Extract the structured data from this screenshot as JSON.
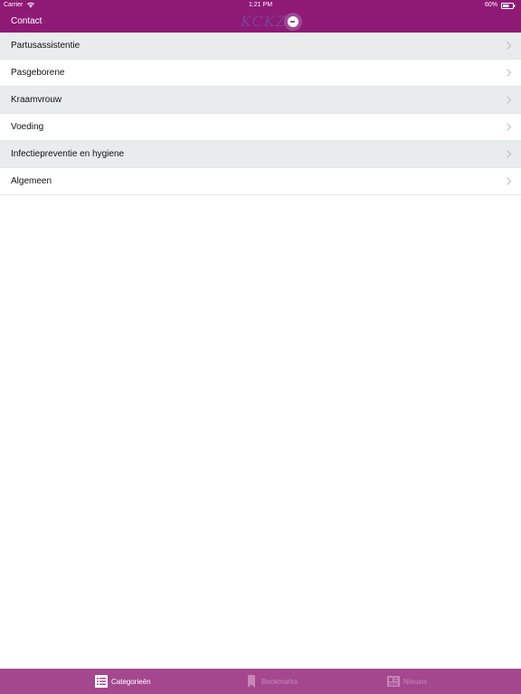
{
  "status_bar": {
    "carrier": "Carrier",
    "time": "1:21 PM",
    "battery": "60%"
  },
  "nav": {
    "contact_label": "Contact",
    "logo_text": "KCKZ"
  },
  "categories": [
    {
      "label": "Partusassistentie"
    },
    {
      "label": "Pasgeborene"
    },
    {
      "label": "Kraamvrouw"
    },
    {
      "label": "Voeding"
    },
    {
      "label": "Infectiepreventie en hygiene"
    },
    {
      "label": "Algemeen"
    }
  ],
  "tabs": [
    {
      "label": "Categorieën",
      "icon": "list-icon",
      "active": true
    },
    {
      "label": "Bookmarks",
      "icon": "bookmark-icon",
      "active": false
    },
    {
      "label": "Nieuws",
      "icon": "newspaper-icon",
      "active": false
    }
  ],
  "colors": {
    "brand": "#8e1a76",
    "tab_bar": "#a4478f",
    "row_shade": "#e9eced",
    "tab_inactive": "#c887b8"
  }
}
